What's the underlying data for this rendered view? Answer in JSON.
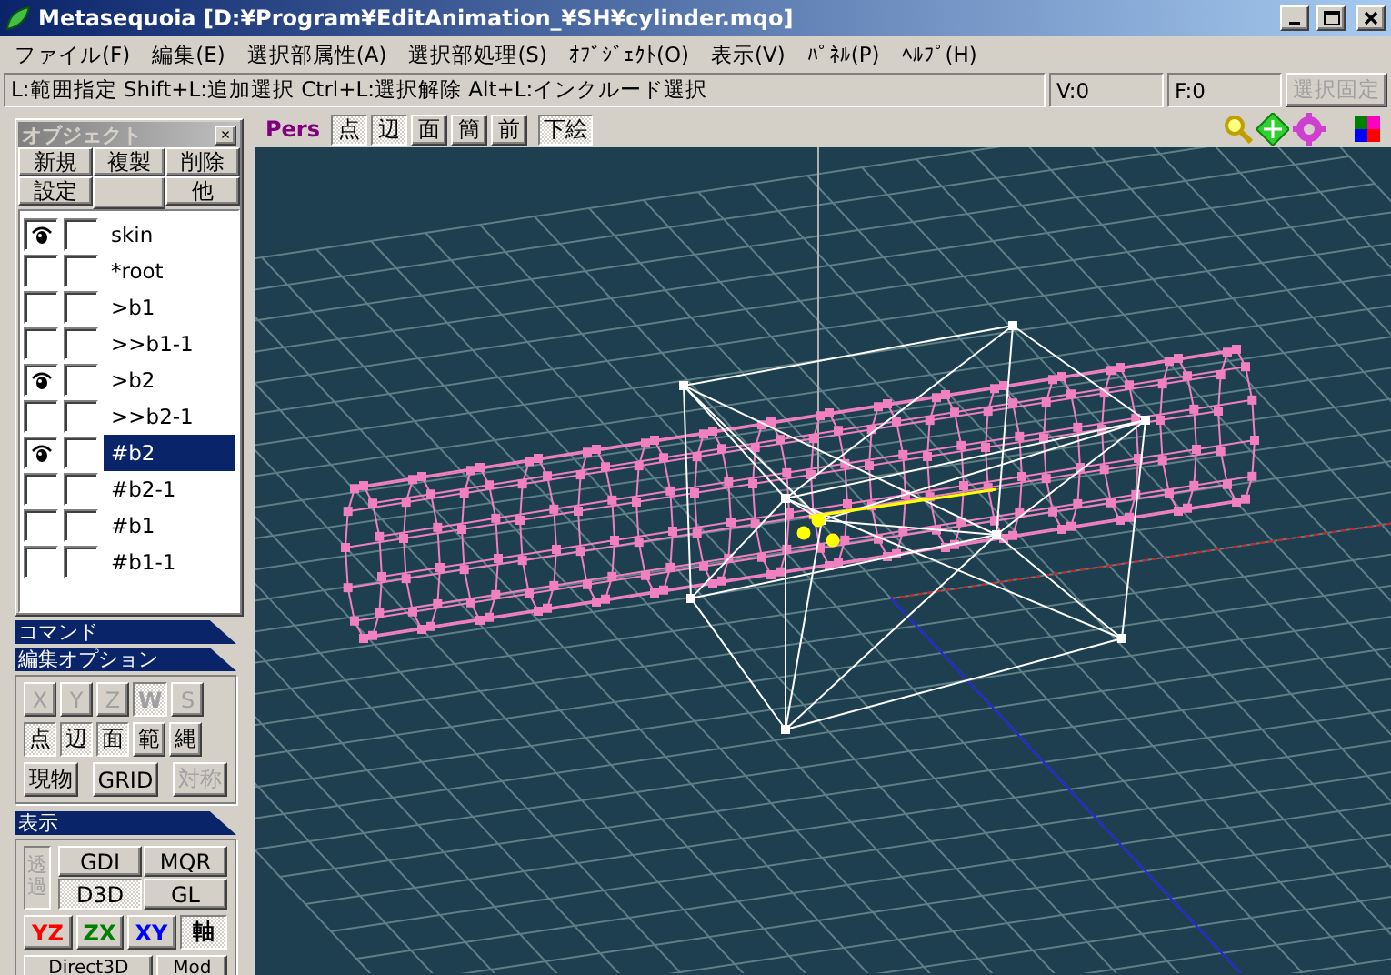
{
  "window": {
    "title": "Metasequoia [D:¥Program¥EditAnimation_¥SH¥cylinder.mqo]"
  },
  "menu": [
    "ファイル(F)",
    "編集(E)",
    "選択部属性(A)",
    "選択部処理(S)",
    "ｵﾌﾞｼﾞｪｸﾄ(O)",
    "表示(V)",
    "ﾊﾟﾈﾙ(P)",
    "ﾍﾙﾌﾟ(H)"
  ],
  "status_bar": {
    "hint": "L:範囲指定  Shift+L:追加選択  Ctrl+L:選択解除  Alt+L:インクルード選択",
    "vertices": "V:0",
    "faces": "F:0",
    "lock_button": {
      "label": "選択固定",
      "disabled": true
    }
  },
  "object_panel": {
    "title": "オブジェクト",
    "close": "×",
    "buttons": [
      "新規",
      "複製",
      "削除",
      "設定",
      "他"
    ],
    "objects": [
      {
        "name": "skin",
        "visible": true,
        "locked": false,
        "selected": false
      },
      {
        "name": "*root",
        "visible": false,
        "locked": false,
        "selected": false
      },
      {
        "name": ">b1",
        "visible": false,
        "locked": false,
        "selected": false
      },
      {
        "name": ">>b1-1",
        "visible": false,
        "locked": false,
        "selected": false
      },
      {
        "name": ">b2",
        "visible": true,
        "locked": false,
        "selected": false
      },
      {
        "name": ">>b2-1",
        "visible": false,
        "locked": false,
        "selected": false
      },
      {
        "name": "#b2",
        "visible": true,
        "locked": false,
        "selected": true
      },
      {
        "name": "#b2-1",
        "visible": false,
        "locked": false,
        "selected": false
      },
      {
        "name": "#b1",
        "visible": false,
        "locked": false,
        "selected": false
      },
      {
        "name": "#b1-1",
        "visible": false,
        "locked": false,
        "selected": false
      }
    ]
  },
  "command_header": "コマンド",
  "edit_options": {
    "title": "編集オプション",
    "groups": [
      [
        {
          "label": "X",
          "pressed": false,
          "disabled": true
        },
        {
          "label": "Y",
          "pressed": false,
          "disabled": true
        },
        {
          "label": "Z",
          "pressed": false,
          "disabled": true
        },
        {
          "label": "W",
          "pressed": true,
          "disabled": true
        },
        {
          "label": "S",
          "pressed": false,
          "disabled": true
        }
      ],
      [
        {
          "label": "点",
          "pressed": true,
          "disabled": false
        },
        {
          "label": "辺",
          "pressed": true,
          "disabled": false
        },
        {
          "label": "面",
          "pressed": true,
          "disabled": false
        },
        {
          "label": "範",
          "pressed": false,
          "disabled": false
        },
        {
          "label": "縄",
          "pressed": false,
          "disabled": false
        }
      ],
      [
        {
          "label": "現物",
          "pressed": false,
          "disabled": false
        },
        {
          "label": "GRID",
          "pressed": false,
          "disabled": false
        },
        {
          "label": "対称",
          "pressed": false,
          "disabled": true
        }
      ]
    ]
  },
  "display": {
    "title": "表示",
    "transparent": {
      "label": "透過",
      "disabled": true
    },
    "renderers": [
      {
        "label": "GDI",
        "selected": false
      },
      {
        "label": "MQR",
        "selected": false
      },
      {
        "label": "D3D",
        "selected": true
      },
      {
        "label": "GL",
        "selected": false
      }
    ],
    "views": [
      {
        "label": "YZ",
        "color": "#ff0000",
        "pressed": false
      },
      {
        "label": "ZX",
        "color": "#008000",
        "pressed": false
      },
      {
        "label": "XY",
        "color": "#0000ff",
        "pressed": false
      },
      {
        "label": "軸",
        "color": "#000000",
        "pressed": true
      }
    ],
    "bottom": [
      "Direct3D",
      "Mod"
    ]
  },
  "viewport": {
    "projection": "Pers",
    "toggles": [
      {
        "label": "点",
        "pressed": true
      },
      {
        "label": "辺",
        "pressed": true
      },
      {
        "label": "面",
        "pressed": false
      },
      {
        "label": "簡",
        "pressed": false
      },
      {
        "label": "前",
        "pressed": false
      },
      {
        "label": "下絵",
        "pressed": true
      }
    ]
  }
}
